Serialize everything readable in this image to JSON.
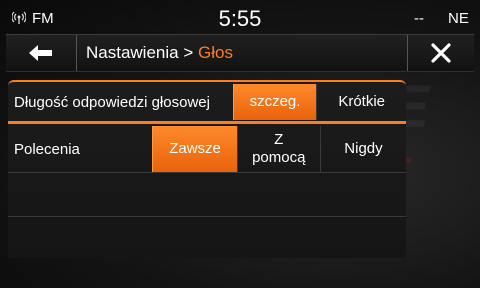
{
  "status": {
    "radio_icon": "radio-wave-icon",
    "source": "FM",
    "time": "5:55",
    "temperature": "--",
    "compass": "NE"
  },
  "header": {
    "back_icon": "arrow-left-icon",
    "breadcrumb_parent": "Nastawienia",
    "breadcrumb_separator": ">",
    "breadcrumb_current": "Głos",
    "close_icon": "close-icon"
  },
  "settings": [
    {
      "label": "Długość odpowiedzi głosowej",
      "options": [
        {
          "label": "szczeg.",
          "selected": true
        },
        {
          "label": "Krótkie",
          "selected": false
        }
      ]
    },
    {
      "label": "Polecenia",
      "options": [
        {
          "label": "Zawsze",
          "selected": true
        },
        {
          "label": "Z pomocą",
          "selected": false
        },
        {
          "label": "Nigdy",
          "selected": false
        }
      ]
    }
  ],
  "colors": {
    "accent": "#ff7c1f",
    "background": "#141414"
  }
}
